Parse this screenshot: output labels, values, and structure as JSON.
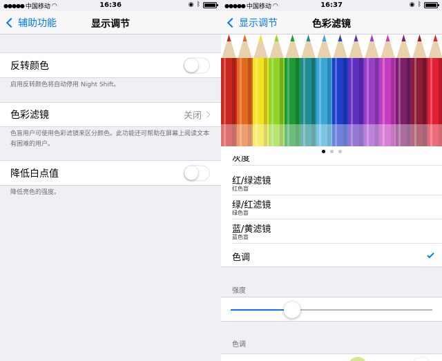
{
  "left": {
    "status": {
      "carrier": "中国移动",
      "time": "16:36"
    },
    "nav": {
      "back": "辅助功能",
      "title": "显示调节"
    },
    "invert": {
      "label": "反转颜色",
      "footer": "启用反转颜色将自动停用 Night Shift。",
      "on": false
    },
    "color_filters": {
      "label": "色彩滤镜",
      "value": "关闭",
      "footer": "色盲用户可使用色彩滤镜来区分颜色。此功能还可帮助在屏幕上阅读文本有困难的用户。"
    },
    "reduce_white": {
      "label": "降低白点值",
      "footer": "降低亮色的强度。",
      "on": false
    }
  },
  "right": {
    "status": {
      "carrier": "中国移动",
      "time": "16:37"
    },
    "nav": {
      "back": "显示调节",
      "title": "色彩滤镜"
    },
    "pencil_colors": [
      "#c9261f",
      "#e46a20",
      "#f2e424",
      "#8fd427",
      "#1d9a35",
      "#1f8c8f",
      "#3aa7d8",
      "#1f3fc9",
      "#5e2fc0",
      "#9b3fc7",
      "#c43cc0",
      "#7b1f6b",
      "#8e1b35",
      "#e22034"
    ],
    "pager": {
      "pages": 3,
      "active": 0
    },
    "filters": [
      {
        "name": "灰度",
        "sub": ""
      },
      {
        "name": "红/绿滤镜",
        "sub": "红色盲"
      },
      {
        "name": "绿/红滤镜",
        "sub": "绿色盲"
      },
      {
        "name": "蓝/黄滤镜",
        "sub": "蓝色盲"
      },
      {
        "name": "色调",
        "sub": "",
        "selected": true
      }
    ],
    "intensity": {
      "label": "强度",
      "value": 0.12
    },
    "hue": {
      "label": "色调"
    },
    "accent": "#007aff"
  }
}
